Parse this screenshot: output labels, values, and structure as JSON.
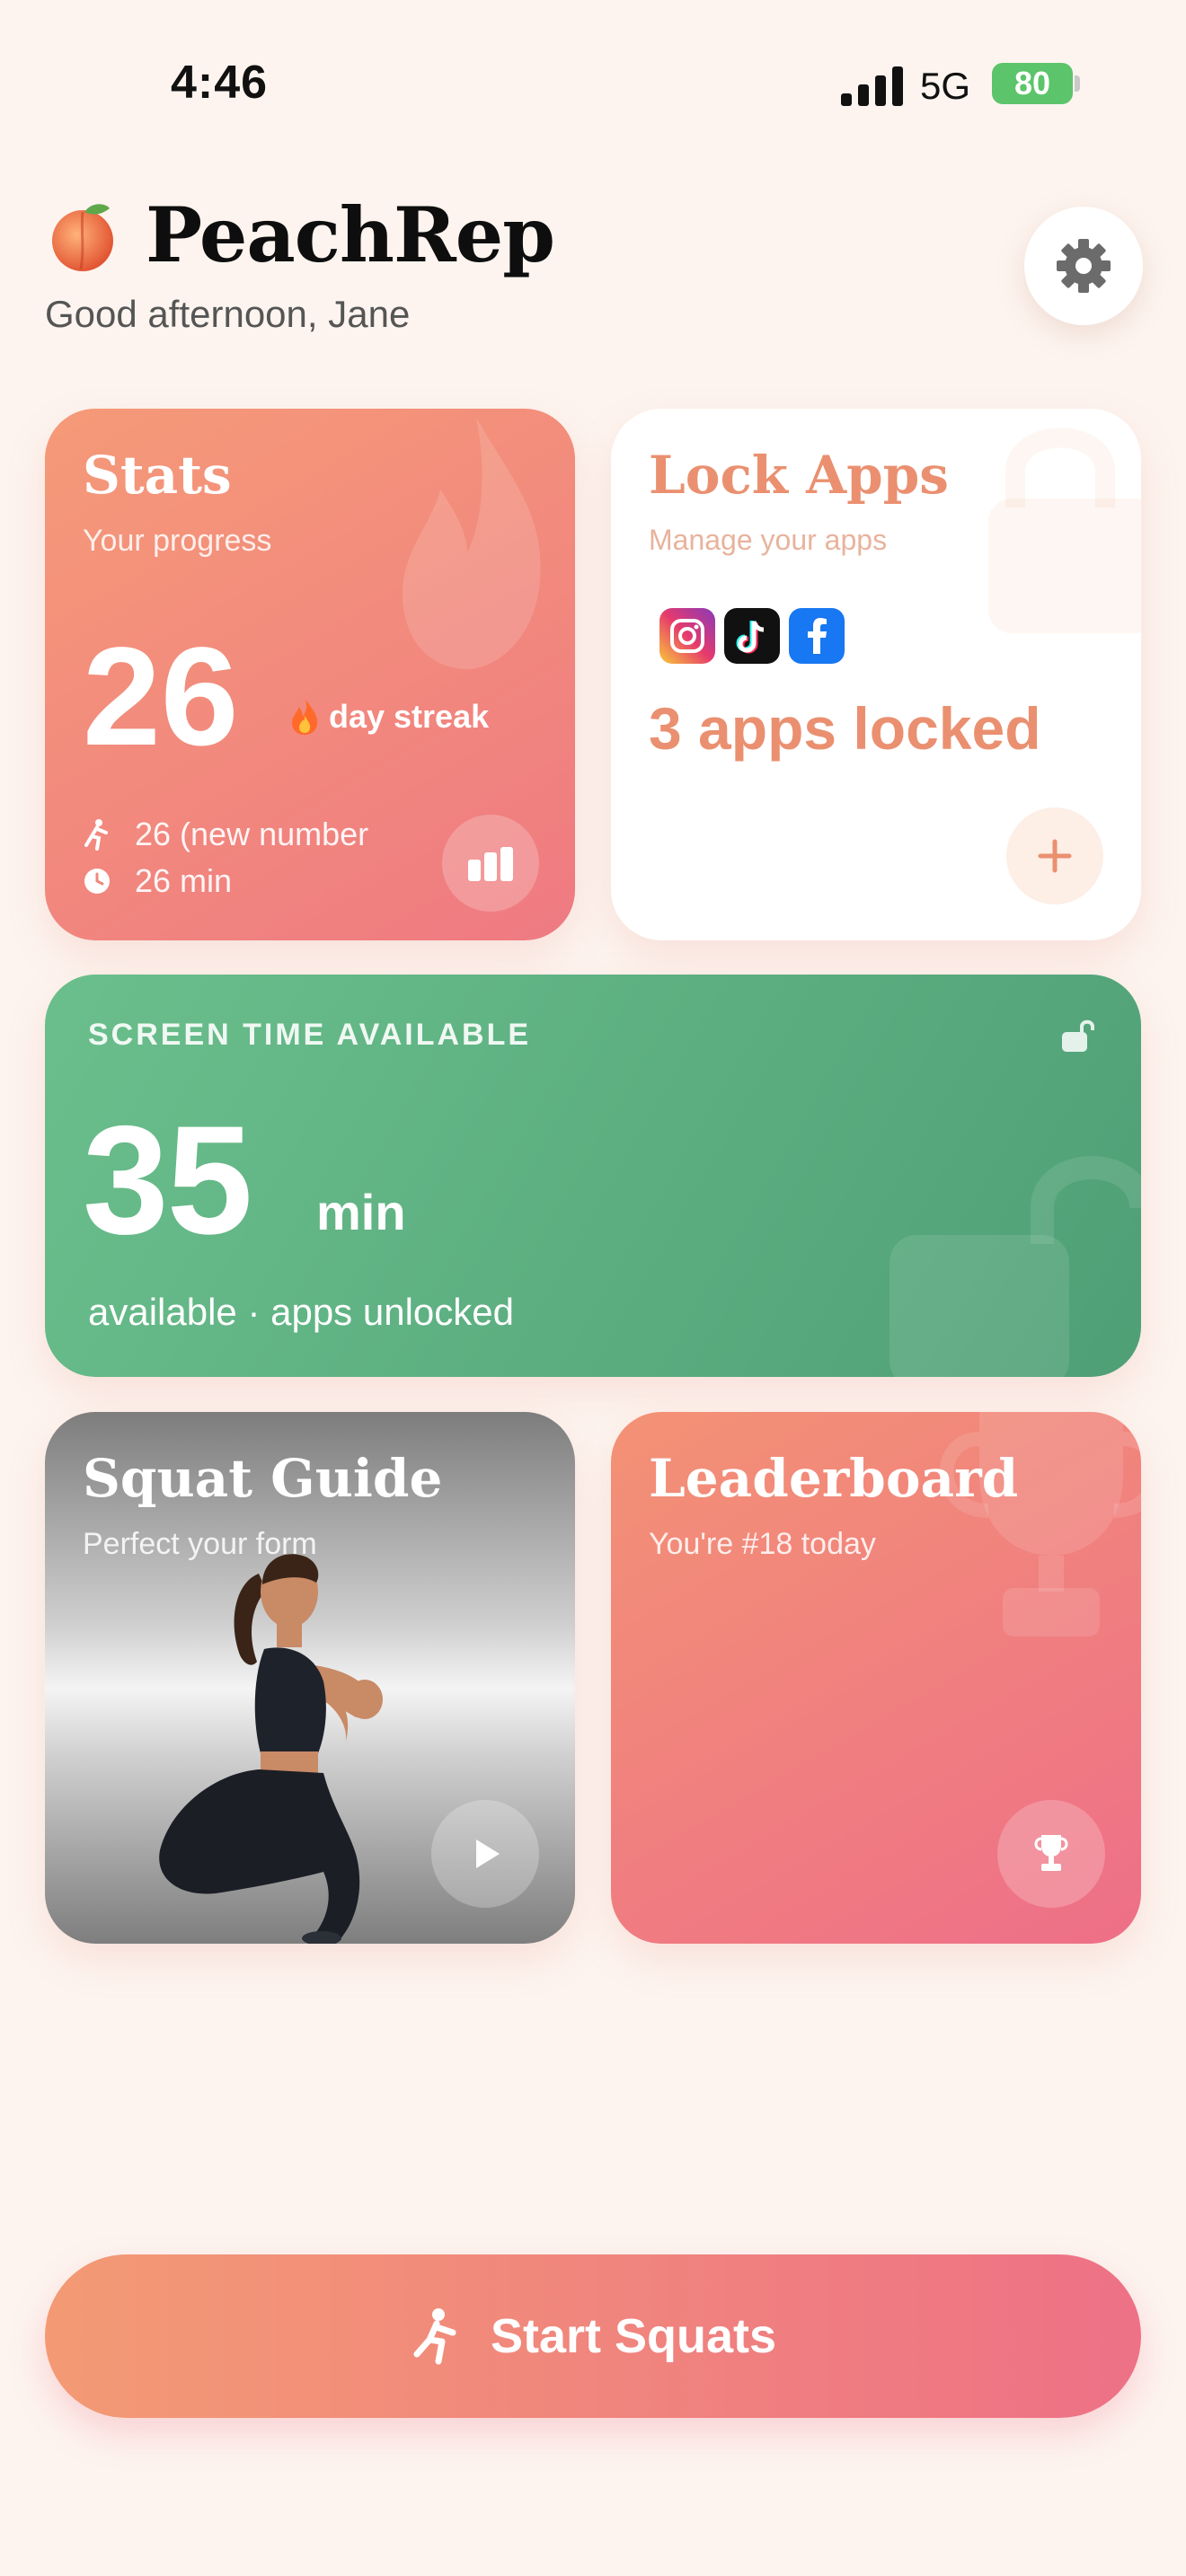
{
  "status_bar": {
    "time": "4:46",
    "network": "5G",
    "battery": "80"
  },
  "header": {
    "title": "PeachRep",
    "greeting": "Good afternoon, Jane"
  },
  "stats_card": {
    "title": "Stats",
    "subtitle": "Your progress",
    "streak_value": "26",
    "streak_label": "day streak",
    "squats_text": "26 (new number",
    "minutes_text": "26 min"
  },
  "lock_card": {
    "title": "Lock Apps",
    "subtitle": "Manage your apps",
    "locked_count": "3 apps locked",
    "apps": [
      "instagram-icon",
      "tiktok-icon",
      "facebook-icon"
    ]
  },
  "screen_time": {
    "label": "SCREEN TIME AVAILABLE",
    "value": "35",
    "unit": "min",
    "status": "available · apps unlocked"
  },
  "squat_card": {
    "title": "Squat Guide",
    "subtitle": "Perfect your form"
  },
  "leader_card": {
    "title": "Leaderboard",
    "subtitle": "You're #18 today"
  },
  "cta": {
    "label": "Start Squats"
  },
  "colors": {
    "peach": "#f59a78",
    "pink": "#ee7186",
    "green": "#5aa97e",
    "lock_accent": "#ea9070",
    "background": "#fdf4ef"
  }
}
